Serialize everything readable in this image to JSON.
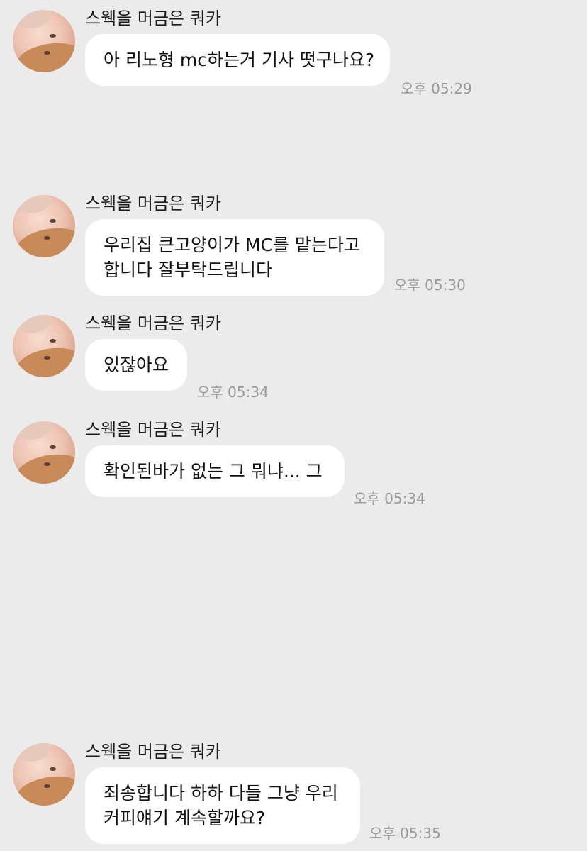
{
  "chat": {
    "messages": [
      {
        "sender": "스웩을 머금은 쿼카",
        "lines": [
          "아 리노형 mc하는거 기사 떳구나요?"
        ],
        "time": "오후 05:29"
      },
      {
        "sender": "스웩을 머금은 쿼카",
        "lines": [
          "우리집 큰고양이가 MC를 맡는다고",
          "합니다 잘부탁드립니다"
        ],
        "time": "오후 05:30"
      },
      {
        "sender": "스웩을 머금은 쿼카",
        "lines": [
          "있잖아요"
        ],
        "time": "오후 05:34"
      },
      {
        "sender": "스웩을 머금은 쿼카",
        "lines": [
          "확인된바가 없는 그 뭐냐... 그"
        ],
        "time": "오후 05:34"
      },
      {
        "sender": "스웩을 머금은 쿼카",
        "lines": [
          "죄송합니다 하하 다들 그냥 우리",
          "커피얘기 계속할까요?"
        ],
        "time": "오후 05:35"
      }
    ]
  }
}
